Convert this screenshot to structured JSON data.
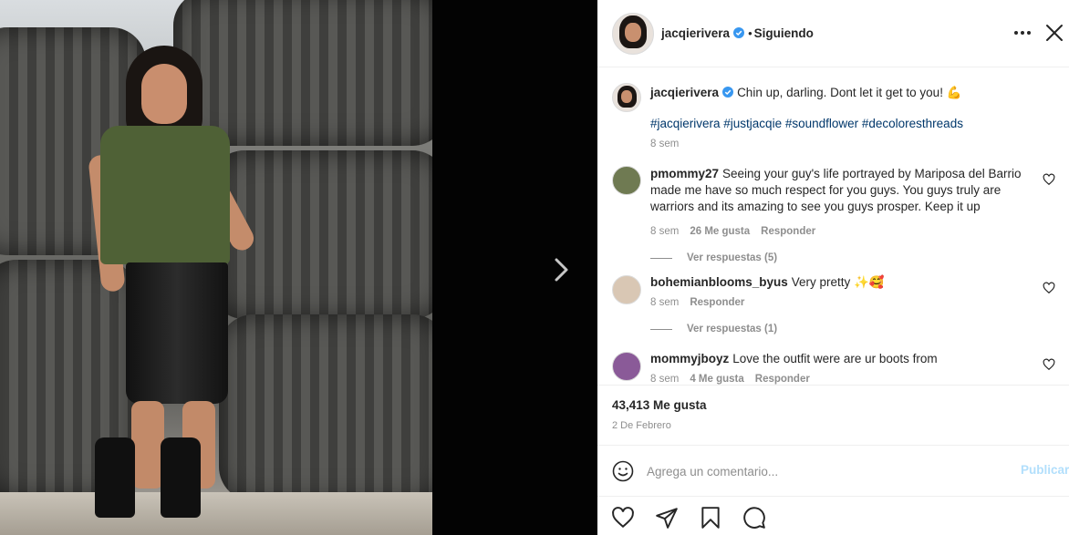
{
  "post": {
    "author": "jacqierivera",
    "follow_status": "Siguiendo",
    "dot": "•",
    "caption": {
      "text": "Chin up, darling. Dont let it get to you!",
      "emoji": "💪",
      "hashtags": "#jacqierivera #justjacqie #soundflower #decoloresthreads",
      "age": "8 sem"
    },
    "likes": "43,413 Me gusta",
    "date": "2 De Febrero"
  },
  "comments": [
    {
      "user": "pmommy27",
      "text": "Seeing your guy's life portrayed by Mariposa del Barrio made me have so much respect for you guys. You guys truly are warriors and its amazing to see you guys prosper. Keep it up",
      "age": "8 sem",
      "likes": "26 Me gusta",
      "reply": "Responder",
      "view_replies": "Ver respuestas (5)"
    },
    {
      "user": "bohemianblooms_byus",
      "text": "Very pretty",
      "emoji": "✨🥰",
      "age": "8 sem",
      "reply": "Responder",
      "view_replies": "Ver respuestas (1)"
    },
    {
      "user": "mommyjboyz",
      "text": "Love the outfit were are ur boots from",
      "age": "8 sem",
      "likes": "4 Me gusta",
      "reply": "Responder"
    }
  ],
  "composer": {
    "placeholder": "Agrega un comentario...",
    "post_label": "Publicar"
  },
  "colors": {
    "verified": "#3897f0",
    "link": "#00376b",
    "muted": "#8e8e8e",
    "post_disabled": "#b2dffc"
  },
  "icons": [
    "verified-badge-icon",
    "more-options-icon",
    "close-icon",
    "next-arrow-icon",
    "heart-icon",
    "emoji-icon",
    "share-icon",
    "bookmark-icon",
    "comment-icon"
  ]
}
